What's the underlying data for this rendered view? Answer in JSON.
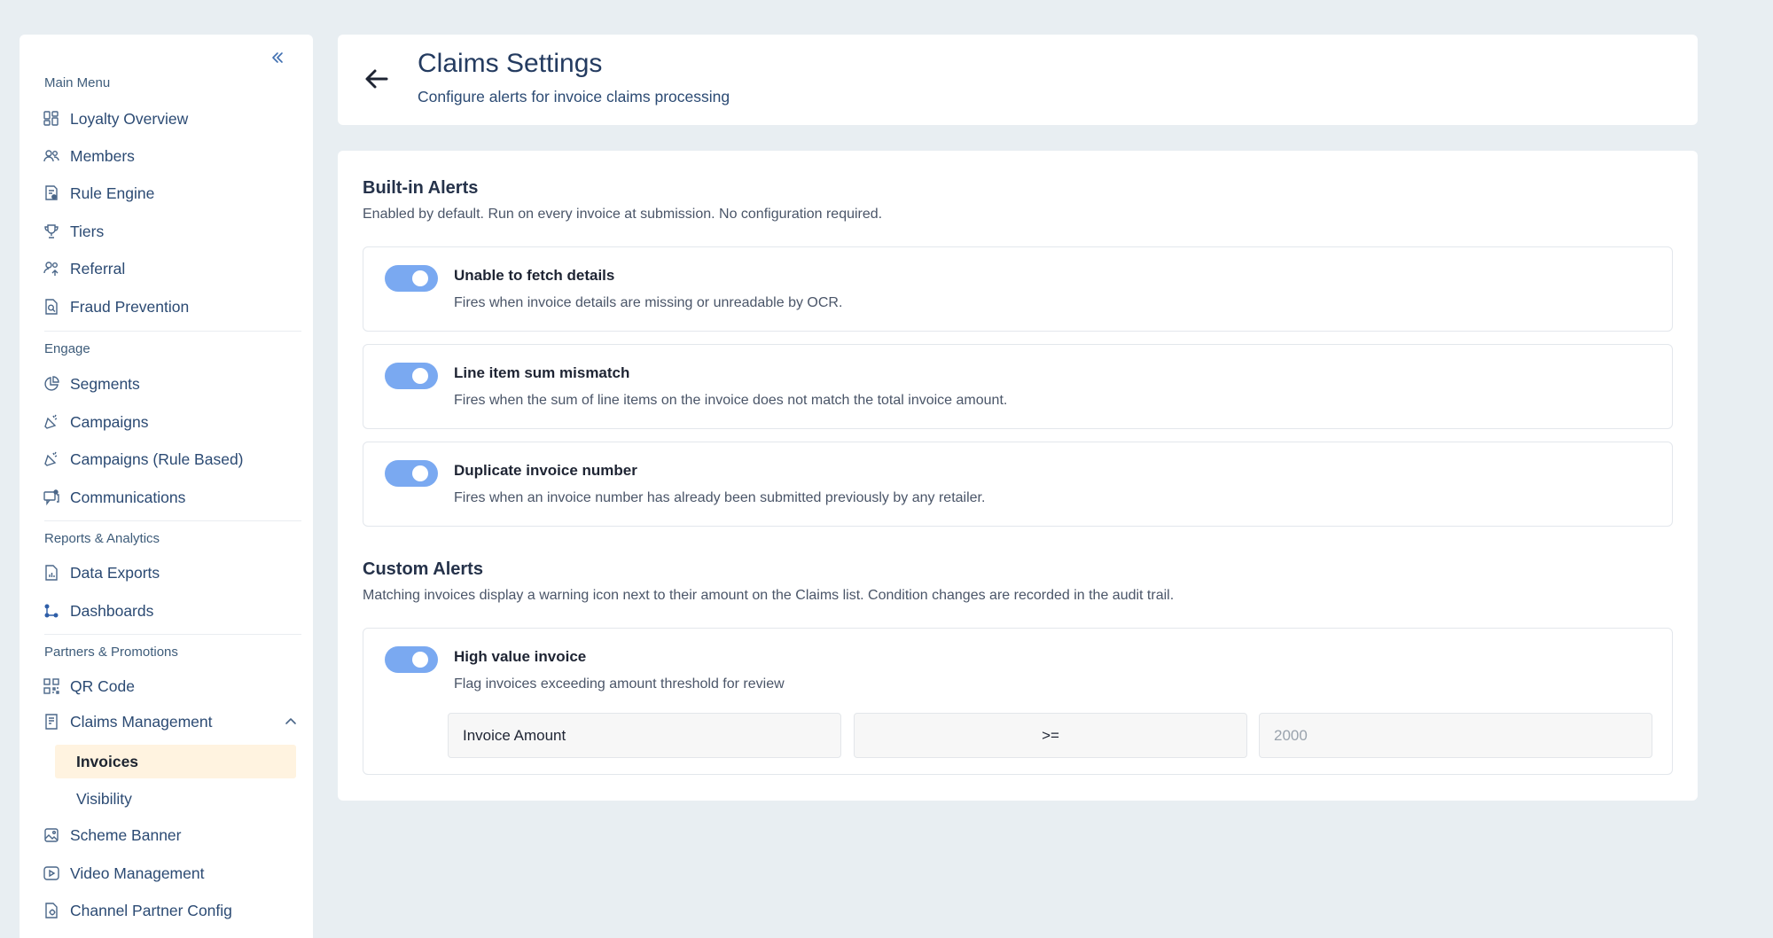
{
  "sidebar": {
    "collapse_icon": "double-chevron-left-icon",
    "sections": {
      "main_menu": "Main Menu",
      "engage": "Engage",
      "reports": "Reports & Analytics",
      "partners": "Partners & Promotions"
    },
    "items": {
      "loyalty_overview": "Loyalty Overview",
      "members": "Members",
      "rule_engine": "Rule Engine",
      "tiers": "Tiers",
      "referral": "Referral",
      "fraud_prevention": "Fraud Prevention",
      "segments": "Segments",
      "campaigns": "Campaigns",
      "campaigns_rule_based": "Campaigns (Rule Based)",
      "communications": "Communications",
      "data_exports": "Data Exports",
      "dashboards": "Dashboards",
      "qr_code": "QR Code",
      "claims_management": "Claims Management",
      "invoices": "Invoices",
      "visibility": "Visibility",
      "scheme_banner": "Scheme Banner",
      "video_management": "Video Management",
      "channel_partner_config": "Channel Partner Config"
    },
    "active_item": "Invoices"
  },
  "header": {
    "title": "Claims Settings",
    "subtitle": "Configure alerts for invoice claims processing"
  },
  "builtin": {
    "title": "Built-in Alerts",
    "description": "Enabled by default. Run on every invoice at submission. No configuration required.",
    "alerts": [
      {
        "name": "Unable to fetch details",
        "description": "Fires when invoice details are missing or unreadable by OCR.",
        "enabled": true
      },
      {
        "name": "Line item sum mismatch",
        "description": "Fires when the sum of line items on the invoice does not match the total invoice amount.",
        "enabled": true
      },
      {
        "name": "Duplicate invoice number",
        "description": "Fires when an invoice number has already been submitted previously by any retailer.",
        "enabled": true
      }
    ]
  },
  "custom": {
    "title": "Custom Alerts",
    "description": "Matching invoices display a warning icon next to their amount on the Claims list. Condition changes are recorded in the audit trail.",
    "alerts": [
      {
        "name": "High value invoice",
        "description": "Flag invoices exceeding amount threshold for review",
        "enabled": true,
        "condition": {
          "field": "Invoice Amount",
          "operator": ">=",
          "value_placeholder": "2000"
        }
      }
    ]
  },
  "colors": {
    "accent": "#7aa9f1",
    "background": "#e8eef2",
    "nav_text": "#2b4a73",
    "active_bg": "#fff3e0"
  }
}
